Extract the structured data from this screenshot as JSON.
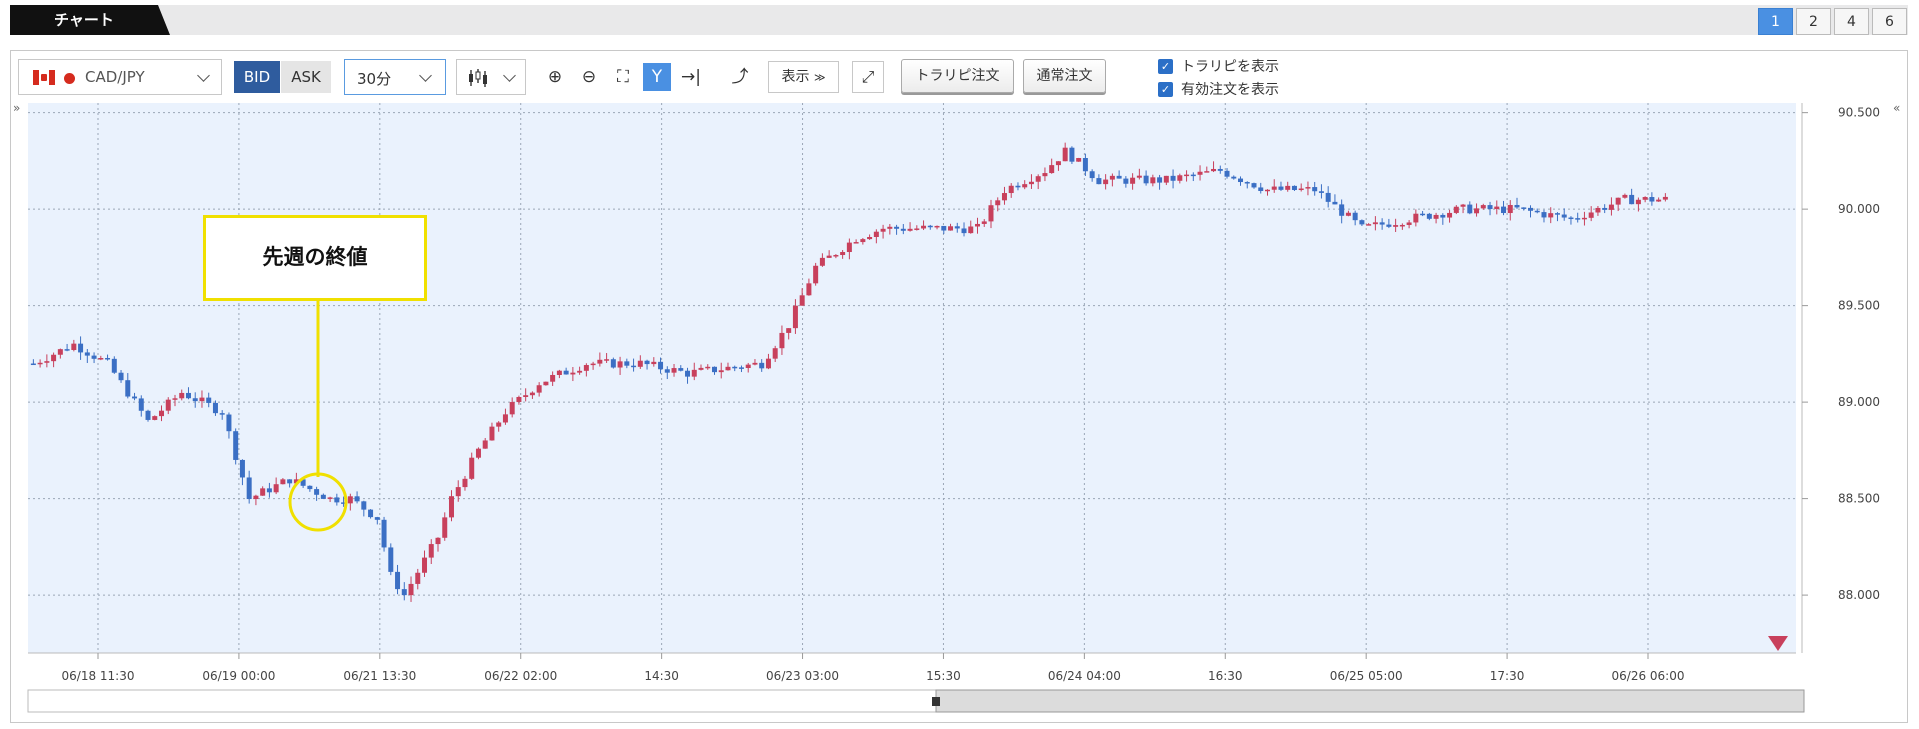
{
  "tab": {
    "label": "チャート"
  },
  "layout_buttons": [
    "1",
    "2",
    "4",
    "6"
  ],
  "toolbar": {
    "symbol": "CAD/JPY",
    "bid": "BID",
    "ask": "ASK",
    "interval": "30分",
    "display": "表示",
    "trailing_order": "トラリピ注文",
    "normal_order": "通常注文",
    "checkboxes": [
      "トラリピを表示",
      "有効注文を表示"
    ]
  },
  "annotation": {
    "text": "先週の終値"
  },
  "colors": {
    "up": "#c8405c",
    "down": "#3b6fc4",
    "plot_bg": "#eaf2fd",
    "accent": "#4a90e2",
    "annotation": "#f0e000"
  },
  "chart_data": {
    "type": "candlestick",
    "y_ticks": [
      "90.500",
      "90.000",
      "89.500",
      "89.000",
      "88.500",
      "88.000"
    ],
    "x_ticks": [
      "06/18 11:30",
      "06/19 00:00",
      "06/21 13:30",
      "06/22 02:00",
      "14:30",
      "06/23 03:00",
      "15:30",
      "06/24 04:00",
      "16:30",
      "06/25 05:00",
      "17:30",
      "06/26 06:00"
    ],
    "ylim": [
      87.7,
      90.55
    ],
    "grid": true,
    "series_path": [
      [
        0,
        89.2
      ],
      [
        6,
        89.3
      ],
      [
        11,
        89.2
      ],
      [
        17,
        88.9
      ],
      [
        22,
        89.05
      ],
      [
        28,
        88.95
      ],
      [
        32,
        88.5
      ],
      [
        38,
        88.6
      ],
      [
        44,
        88.5
      ],
      [
        47,
        88.5
      ],
      [
        51,
        88.4
      ],
      [
        53,
        88.1
      ],
      [
        55,
        88.0
      ],
      [
        60,
        88.3
      ],
      [
        62,
        88.5
      ],
      [
        66,
        88.75
      ],
      [
        70,
        88.95
      ],
      [
        75,
        89.1
      ],
      [
        82,
        89.2
      ],
      [
        90,
        89.2
      ],
      [
        97,
        89.15
      ],
      [
        108,
        89.2
      ],
      [
        112,
        89.4
      ],
      [
        116,
        89.7
      ],
      [
        122,
        89.85
      ],
      [
        126,
        89.9
      ],
      [
        134,
        89.9
      ],
      [
        140,
        89.9
      ],
      [
        144,
        90.1
      ],
      [
        150,
        90.2
      ],
      [
        153,
        90.3
      ],
      [
        158,
        90.15
      ],
      [
        168,
        90.15
      ],
      [
        176,
        90.2
      ],
      [
        183,
        90.1
      ],
      [
        190,
        90.1
      ],
      [
        197,
        89.9
      ],
      [
        204,
        89.95
      ],
      [
        212,
        90.0
      ],
      [
        220,
        90.0
      ],
      [
        228,
        89.95
      ],
      [
        236,
        90.05
      ],
      [
        242,
        90.05
      ]
    ],
    "last_price_marker": "down-triangle"
  }
}
